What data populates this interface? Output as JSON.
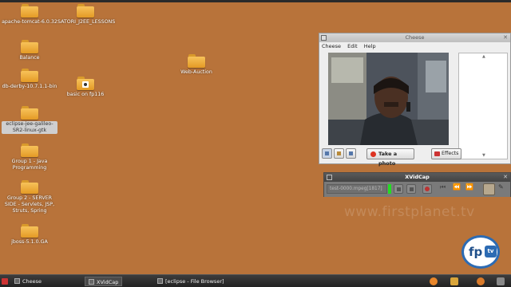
{
  "desktop": {
    "icons": [
      {
        "label": "apache-tomcat-6.0.32"
      },
      {
        "label": "SATORI_J2EE_LESSONS"
      },
      {
        "label": "Balance"
      },
      {
        "label": "db-derby-10.7.1.1-bin"
      },
      {
        "label": "basic on fp116"
      },
      {
        "label": "Web-Auction"
      },
      {
        "label": "eclipse-jee-galileo-SR2-linux-gtk"
      },
      {
        "label": "Group 1 - Java Programming"
      },
      {
        "label": "Group 2 - SERVER SIDE - Servlets, JSP, Struts, Spring"
      },
      {
        "label": "jboss-5.1.0.GA"
      }
    ]
  },
  "cheese": {
    "title": "Cheese",
    "menu": [
      "Cheese",
      "Edit",
      "Help"
    ],
    "take_photo": "Take a photo",
    "effects": "Effects"
  },
  "xvidcap": {
    "title": "XVidCap",
    "filename": "test-0000.mpeg[1817]"
  },
  "watermark": "www.firstplanet.tv",
  "logo": {
    "text": "fp",
    "badge": "tv"
  },
  "taskbar": {
    "items": [
      "Cheese",
      "XVidCap",
      "[eclipse - File Browser]"
    ]
  },
  "colors": {
    "desktop": "#b8733a",
    "taskbar": "#2a2a2a",
    "accent": "#2c6bb3"
  }
}
